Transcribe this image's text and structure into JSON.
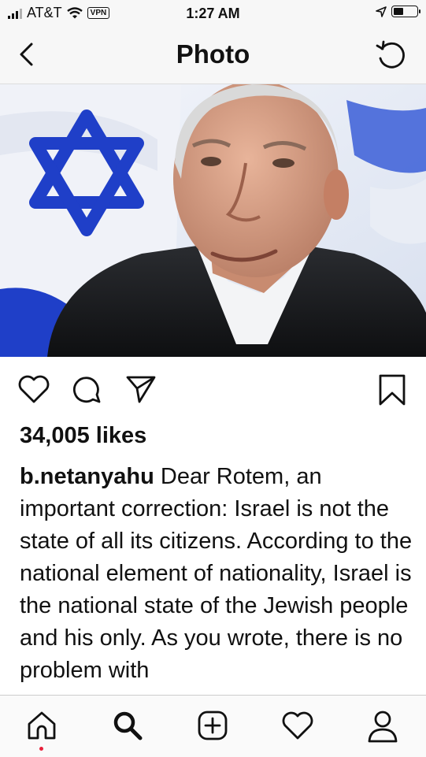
{
  "status": {
    "carrier": "AT&T",
    "vpn": "VPN",
    "time": "1:27 AM"
  },
  "nav": {
    "title": "Photo"
  },
  "post": {
    "likes": "34,005 likes",
    "username": "b.netanyahu",
    "caption": "Dear Rotem, an important correction: Israel is not the state of all its citizens. According to the national element of nationality, Israel is the national state of the Jewish people and his only. As you wrote, there is no problem with"
  },
  "colors": {
    "flag_blue": "#1f3fc8",
    "notification_dot": "#e8203a"
  },
  "icons": [
    "back-icon",
    "refresh-icon",
    "heart-icon",
    "comment-icon",
    "share-icon",
    "bookmark-icon",
    "home-icon",
    "search-icon",
    "add-icon",
    "activity-icon",
    "profile-icon"
  ]
}
